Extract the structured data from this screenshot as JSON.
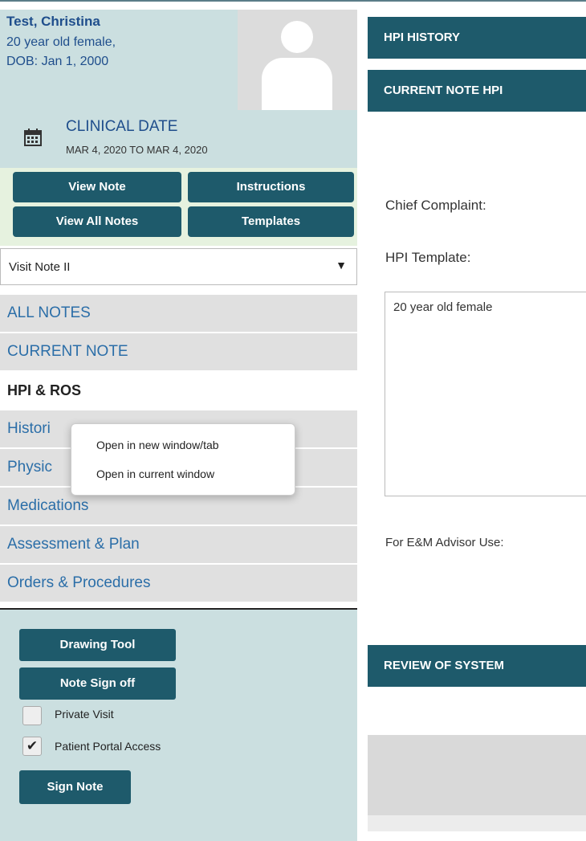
{
  "patient": {
    "name": "Test, Christina",
    "age_sex": "20 year old female,",
    "dob": "DOB: Jan 1, 2000"
  },
  "clinical_date": {
    "title": "CLINICAL DATE",
    "range": "MAR 4, 2020 TO MAR 4, 2020"
  },
  "top_buttons": {
    "view_note": "View Note",
    "instructions": "Instructions",
    "view_all_notes": "View All Notes",
    "templates": "Templates"
  },
  "note_select": {
    "value": "Visit Note II",
    "arrow": "▼"
  },
  "nav": {
    "items": [
      "ALL NOTES",
      "CURRENT NOTE",
      "HPI & ROS",
      "History & Habits",
      "Physical Exam",
      "Medications",
      "Assessment & Plan",
      "Orders & Procedures"
    ],
    "visible_labels": [
      "Histori",
      "Physic"
    ]
  },
  "context_menu": {
    "items": [
      "Open in new window/tab",
      "Open in current window"
    ]
  },
  "bottom_panel": {
    "drawing_tool": "Drawing Tool",
    "note_sign_off": "Note Sign off",
    "private_visit": "Private Visit",
    "portal_access": "Patient Portal Access",
    "sign_note": "Sign Note",
    "private_visit_checked": false,
    "portal_access_checked": true,
    "check_glyph": "✔"
  },
  "right": {
    "hpi_history": "HPI HISTORY",
    "current_note_hpi": "CURRENT NOTE HPI",
    "chief_complaint": "Chief Complaint:",
    "hpi_template": "HPI Template:",
    "hpi_text": "20 year old female",
    "em_advisor": "For E&M Advisor Use:",
    "review_of_system": "REVIEW OF SYSTEM"
  },
  "colors": {
    "accent": "#1e5a6b",
    "link": "#2b6ea8",
    "panel": "#cbdfe0"
  }
}
